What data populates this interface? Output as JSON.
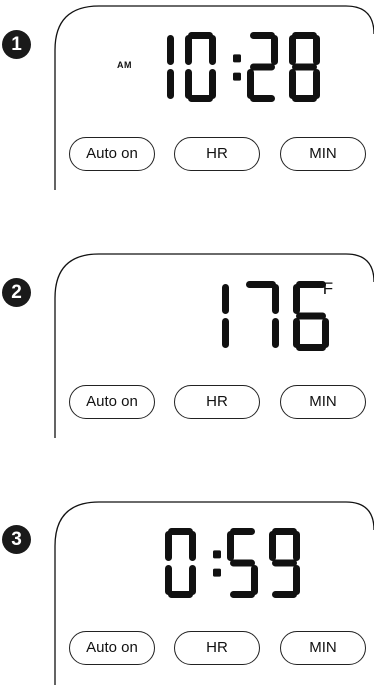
{
  "panels": [
    {
      "step": "1",
      "time_prefix": "AM",
      "display": "10:28",
      "unit": "",
      "buttons": {
        "auto_on": "Auto on",
        "hr": "HR",
        "min": "MIN"
      }
    },
    {
      "step": "2",
      "time_prefix": "",
      "display": "176",
      "unit": "°F",
      "buttons": {
        "auto_on": "Auto on",
        "hr": "HR",
        "min": "MIN"
      }
    },
    {
      "step": "3",
      "time_prefix": "",
      "display": "0:59",
      "unit": "",
      "buttons": {
        "auto_on": "Auto on",
        "hr": "HR",
        "min": "MIN"
      }
    }
  ],
  "colors": {
    "ink": "#111111",
    "background": "#ffffff"
  }
}
